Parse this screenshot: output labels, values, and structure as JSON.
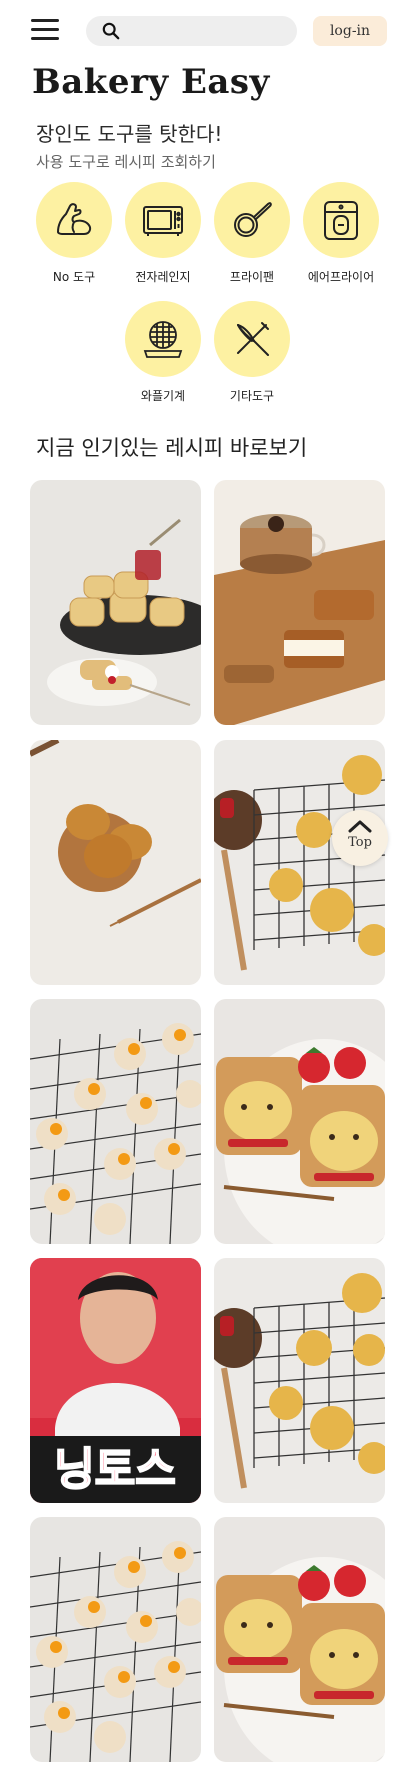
{
  "header": {
    "search_placeholder": "",
    "login_label": "log-in"
  },
  "brand": "Bakery Easy",
  "hero": {
    "title": "장인도 도구를 탓한다!",
    "subtitle": "사용 도구로 레시피 조회하기"
  },
  "tools": [
    {
      "label": "No 도구",
      "icon": "arm-muscle-icon"
    },
    {
      "label": "전자레인지",
      "icon": "microwave-icon"
    },
    {
      "label": "프라이팬",
      "icon": "frying-pan-icon"
    },
    {
      "label": "에어프라이어",
      "icon": "air-fryer-icon"
    },
    {
      "label": "와플기계",
      "icon": "waffle-maker-icon"
    },
    {
      "label": "기타도구",
      "icon": "whisk-icon"
    }
  ],
  "popular": {
    "title": "지금 인기있는 레시피 바로보기",
    "cards": [
      {
        "image": "scones-jam-photo"
      },
      {
        "image": "dalgona-coffee-lotus-photo"
      },
      {
        "image": "madeleines-plate-photo"
      },
      {
        "image": "cream-puffs-rack-photo"
      },
      {
        "image": "orange-tarts-rack-photo"
      },
      {
        "image": "bear-toast-strawberries-photo"
      },
      {
        "image": "chef-video-thumbnail-photo",
        "overlay_text": "닝토스"
      },
      {
        "image": "cream-puffs-rack-photo"
      },
      {
        "image": "orange-tarts-rack-photo"
      },
      {
        "image": "bear-toast-strawberries-photo"
      }
    ]
  },
  "top_button_label": "Top",
  "colors": {
    "tool_circle": "#fdf1a2",
    "login_bg": "#fbecd9",
    "search_bg": "#eeeeee",
    "top_btn_bg": "#f8f0e2"
  }
}
